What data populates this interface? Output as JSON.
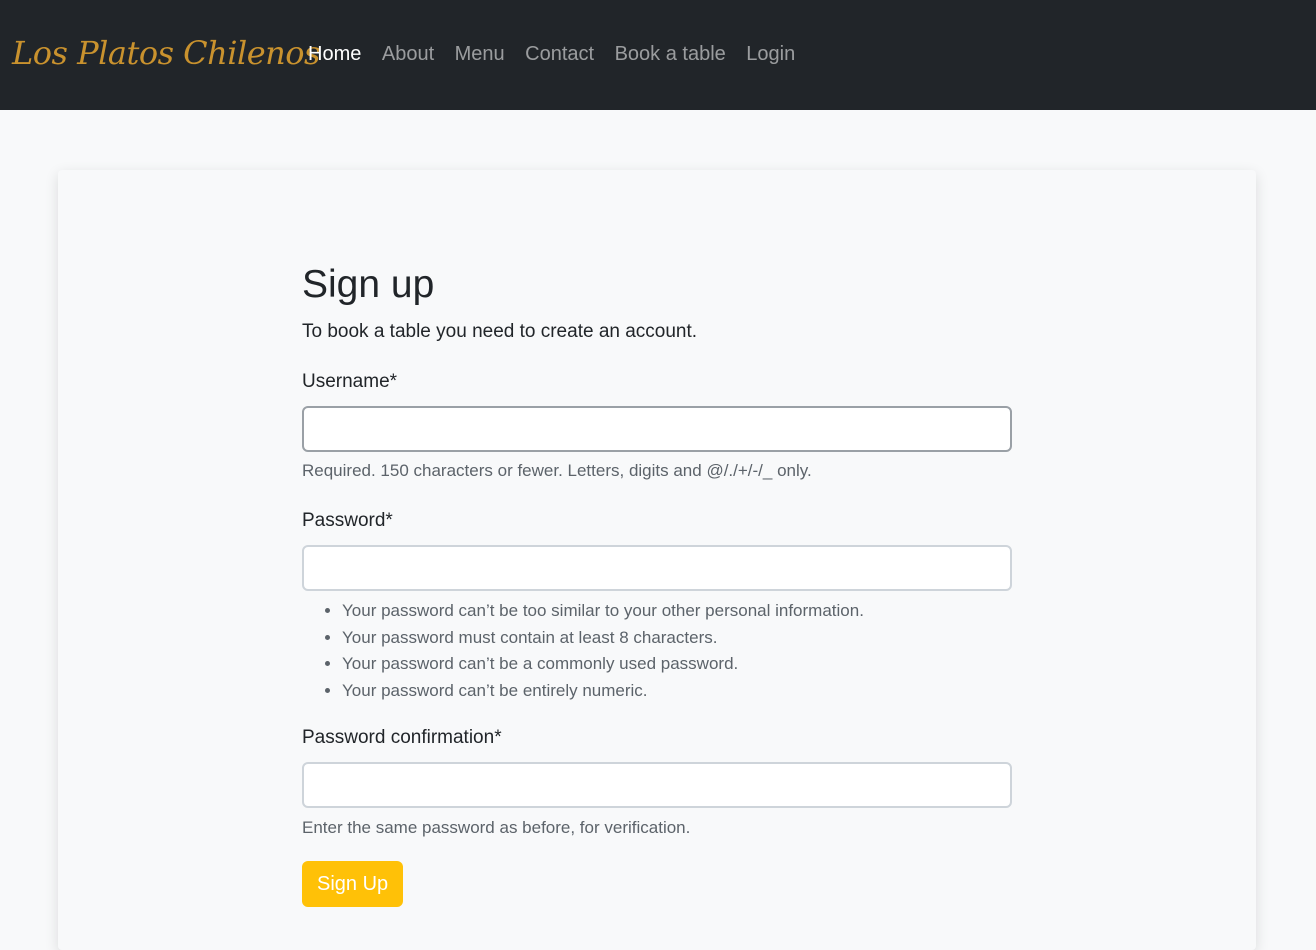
{
  "navbar": {
    "brand": "Los Platos Chilenos",
    "links": [
      {
        "label": "Home",
        "active": true
      },
      {
        "label": "About",
        "active": false
      },
      {
        "label": "Menu",
        "active": false
      },
      {
        "label": "Contact",
        "active": false
      },
      {
        "label": "Book a table",
        "active": false
      },
      {
        "label": "Login",
        "active": false
      }
    ]
  },
  "form": {
    "title": "Sign up",
    "lead": "To book a table you need to create an account.",
    "username": {
      "label": "Username*",
      "value": "",
      "help": "Required. 150 characters or fewer. Letters, digits and @/./+/-/_ only."
    },
    "password": {
      "label": "Password*",
      "value": "",
      "help_items": [
        "Your password can’t be too similar to your other personal information.",
        "Your password must contain at least 8 characters.",
        "Your password can’t be a commonly used password.",
        "Your password can’t be entirely numeric."
      ]
    },
    "password_confirmation": {
      "label": "Password confirmation*",
      "value": "",
      "help": "Enter the same password as before, for verification."
    },
    "submit_label": "Sign Up"
  },
  "colors": {
    "navbar_bg": "#212529",
    "brand": "#c9922e",
    "button": "#ffc107",
    "page_bg": "#f8f9fa"
  }
}
